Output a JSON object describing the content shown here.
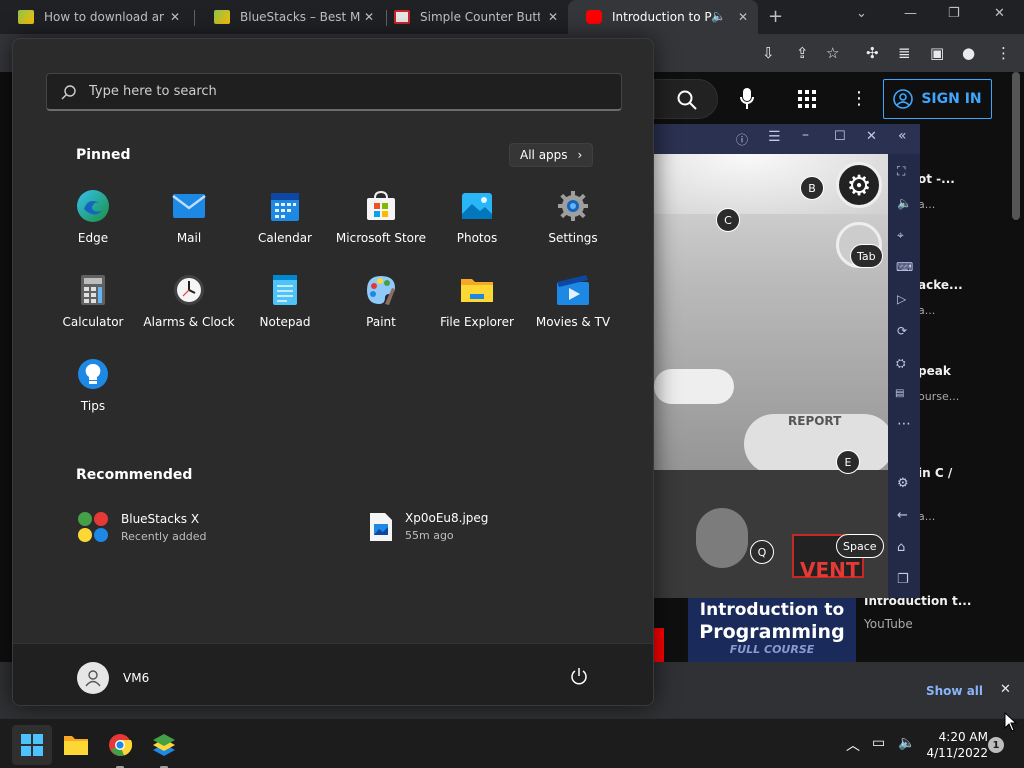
{
  "browser": {
    "tabs": [
      {
        "title": "How to download and i",
        "active": false
      },
      {
        "title": "BlueStacks – Best Mobi",
        "active": false
      },
      {
        "title": "Simple Counter Button",
        "active": false
      },
      {
        "title": "Introduction to Pro",
        "active": true
      }
    ],
    "new_tab": "+",
    "minimize": "—",
    "restore": "❐",
    "close": "✕"
  },
  "youtube": {
    "sign_in": "SIGN IN",
    "sidebar": [
      {
        "title": "ot -...",
        "sub": "a..."
      },
      {
        "title": "acke...",
        "sub": "a..."
      },
      {
        "title": "peak",
        "sub": "ourse..."
      },
      {
        "title": "in C /",
        "sub": "a..."
      }
    ],
    "bottom_title": "Introduction t...",
    "bottom_channel": "YouTube",
    "thumb_title_line1": "Introduction to",
    "thumb_title_line2": "Programming",
    "thumb_sub": "FULL COURSE",
    "show_all": "Show all"
  },
  "bluestacks": {
    "keys": [
      "B",
      "C",
      "Tab",
      "E",
      "Q",
      "Space"
    ],
    "game_text": "VENT",
    "report_text": "REPORT"
  },
  "start_menu": {
    "search_placeholder": "Type here to search",
    "pinned_title": "Pinned",
    "all_apps": "All apps",
    "pinned": [
      {
        "label": "Edge",
        "icon": "edge-icon"
      },
      {
        "label": "Mail",
        "icon": "mail-icon"
      },
      {
        "label": "Calendar",
        "icon": "calendar-icon"
      },
      {
        "label": "Microsoft Store",
        "icon": "store-icon"
      },
      {
        "label": "Photos",
        "icon": "photos-icon"
      },
      {
        "label": "Settings",
        "icon": "settings-icon"
      },
      {
        "label": "Calculator",
        "icon": "calculator-icon"
      },
      {
        "label": "Alarms & Clock",
        "icon": "clock-icon"
      },
      {
        "label": "Notepad",
        "icon": "notepad-icon"
      },
      {
        "label": "Paint",
        "icon": "paint-icon"
      },
      {
        "label": "File Explorer",
        "icon": "folder-icon"
      },
      {
        "label": "Movies & TV",
        "icon": "movies-icon"
      },
      {
        "label": "Tips",
        "icon": "tips-icon"
      }
    ],
    "recommended_title": "Recommended",
    "recommended": [
      {
        "title": "BlueStacks X",
        "sub": "Recently added"
      },
      {
        "title": "Xp0oEu8.jpeg",
        "sub": "55m ago"
      }
    ],
    "user": "VM6"
  },
  "taskbar": {
    "time": "4:20 AM",
    "date": "4/11/2022",
    "notifications": "1"
  }
}
